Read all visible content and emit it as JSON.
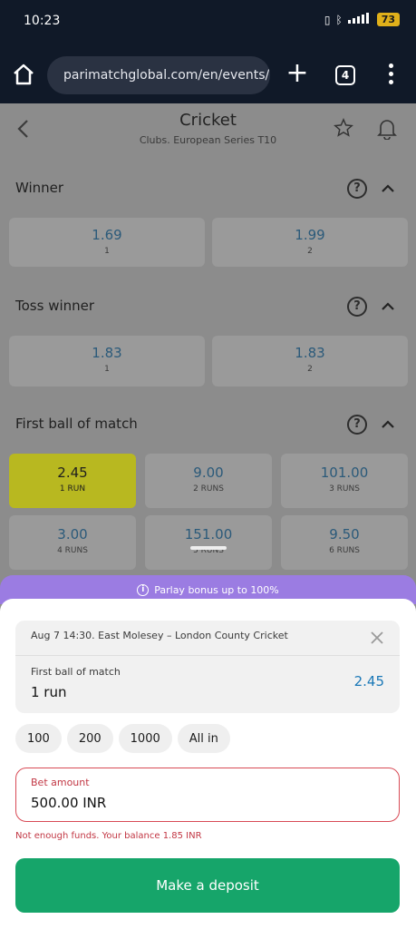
{
  "status_bar": {
    "time": "10:23",
    "battery": "73"
  },
  "browser": {
    "url": "parimatchglobal.com/en/events/ec",
    "tab_count": "4"
  },
  "page": {
    "title": "Cricket",
    "subtitle": "Clubs. European Series T10",
    "markets": [
      {
        "title": "Winner",
        "odds": [
          {
            "value": "1.69",
            "label": "1"
          },
          {
            "value": "1.99",
            "label": "2"
          }
        ]
      },
      {
        "title": "Toss winner",
        "odds": [
          {
            "value": "1.83",
            "label": "1"
          },
          {
            "value": "1.83",
            "label": "2"
          }
        ]
      },
      {
        "title": "First ball of match",
        "odds": [
          {
            "value": "2.45",
            "label": "1 RUN"
          },
          {
            "value": "9.00",
            "label": "2 RUNS"
          },
          {
            "value": "101.00",
            "label": "3 RUNS"
          },
          {
            "value": "3.00",
            "label": "4 RUNS"
          },
          {
            "value": "151.00",
            "label": "5 RUNS"
          },
          {
            "value": "9.50",
            "label": "6 RUNS"
          }
        ]
      }
    ]
  },
  "parlay": {
    "text": "Parlay bonus up to 100%"
  },
  "bet_slip": {
    "event": "Aug 7 14:30. East Molesey – London County Cricket",
    "market": "First ball of match",
    "selection": "1 run",
    "odds": "2.45",
    "quick_amounts": [
      "100",
      "200",
      "1000",
      "All in"
    ],
    "amount_label": "Bet amount",
    "amount_value": "500.00 INR",
    "error": "Not enough funds. Your balance 1.85 INR",
    "deposit_label": "Make a deposit"
  },
  "colors": {
    "accent_green": "#16a56a",
    "error_red": "#c23744",
    "parlay_purple": "#9b7ce2",
    "odds_blue": "#1a78b7",
    "selected_yellow": "#b8b820"
  }
}
